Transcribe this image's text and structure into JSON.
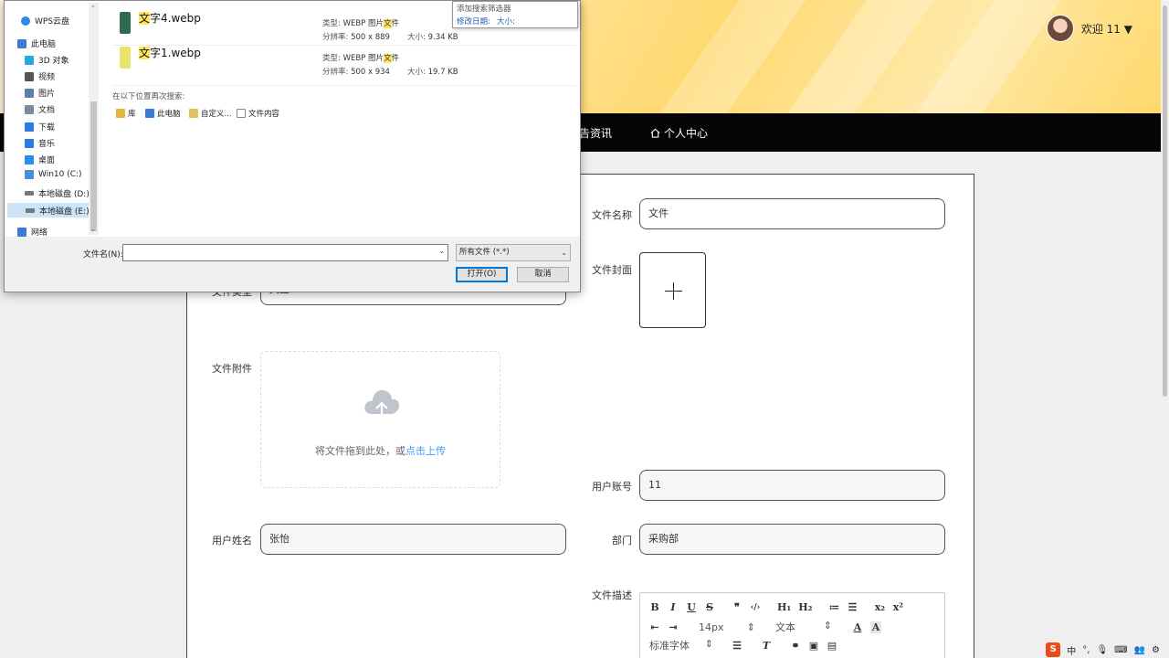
{
  "header": {
    "welcome": "欢迎 11 ▼"
  },
  "nav": {
    "news": "告资讯",
    "user_center": "个人中心"
  },
  "form": {
    "file_name": {
      "label": "文件名称",
      "value": "文件"
    },
    "file_cover": {
      "label": "文件封面"
    },
    "file_type": {
      "label": "文件类型",
      "value": "文登"
    },
    "attachment": {
      "label": "文件附件",
      "drop_text": "将文件拖到此处，或",
      "drop_link": "点击上传"
    },
    "account": {
      "label": "用户账号",
      "value": "11"
    },
    "user_name": {
      "label": "用户姓名",
      "value": "张怡"
    },
    "department": {
      "label": "部门",
      "value": "采购部"
    },
    "description": {
      "label": "文件描述"
    }
  },
  "editor": {
    "row1": [
      "B",
      "I",
      "U",
      "S",
      "❞",
      "‹/›",
      "H₁",
      "H₂",
      "≔",
      "☰",
      "x₂",
      "x²"
    ],
    "font_size": "14px",
    "text_style": "文本",
    "font_family": "标准字体"
  },
  "dialog": {
    "nav_items": [
      {
        "label": "WPS云盘",
        "color": "#2f8ae5"
      },
      {
        "label": "此电脑",
        "color": "#3a7bd5"
      },
      {
        "label": "3D 对象",
        "color": "#29a8e0"
      },
      {
        "label": "视频",
        "color": "#555555"
      },
      {
        "label": "图片",
        "color": "#5f7fa0"
      },
      {
        "label": "文档",
        "color": "#7a8aa0"
      },
      {
        "label": "下载",
        "color": "#2a7be4"
      },
      {
        "label": "音乐",
        "color": "#2a7be4"
      },
      {
        "label": "桌面",
        "color": "#2a8fe4"
      },
      {
        "label": "Win10 (C:)",
        "color": "#4a90d9"
      },
      {
        "label": "本地磁盘 (D:)",
        "color": "#777777"
      },
      {
        "label": "本地磁盘 (E:)",
        "color": "#777777"
      },
      {
        "label": "网络",
        "color": "#3a7bd5"
      }
    ],
    "filter": {
      "title": "添加搜索筛选器",
      "date": "修改日期:",
      "size": "大小:"
    },
    "results": [
      {
        "name_highlight": "文",
        "name_rest": "字4.webp",
        "type_label": "类型:",
        "type_value_pre": "WEBP 图片",
        "type_value_hl": "文",
        "type_value_post": "件",
        "res_label": "分辨率:",
        "res_value": "500 x 889",
        "size_label": "大小:",
        "size_value": "9.34 KB",
        "thumb_color": "#2e6b4f"
      },
      {
        "name_highlight": "文",
        "name_rest": "字1.webp",
        "type_label": "类型:",
        "type_value_pre": "WEBP 图片",
        "type_value_hl": "文",
        "type_value_post": "件",
        "res_label": "分辨率:",
        "res_value": "500 x 934",
        "size_label": "大小:",
        "size_value": "19.7 KB",
        "thumb_color": "#e8e36a"
      }
    ],
    "search_again_label": "在以下位置再次搜索:",
    "locations": [
      "库",
      "此电脑",
      "自定义...",
      "文件内容"
    ],
    "filename_label": "文件名(N):",
    "filename_value": "",
    "file_type": "所有文件 (*.*)",
    "open_button": "打开(O)",
    "cancel_button": "取消"
  },
  "tray": {
    "ime": "S",
    "lang": "中",
    "punct": "°,"
  }
}
